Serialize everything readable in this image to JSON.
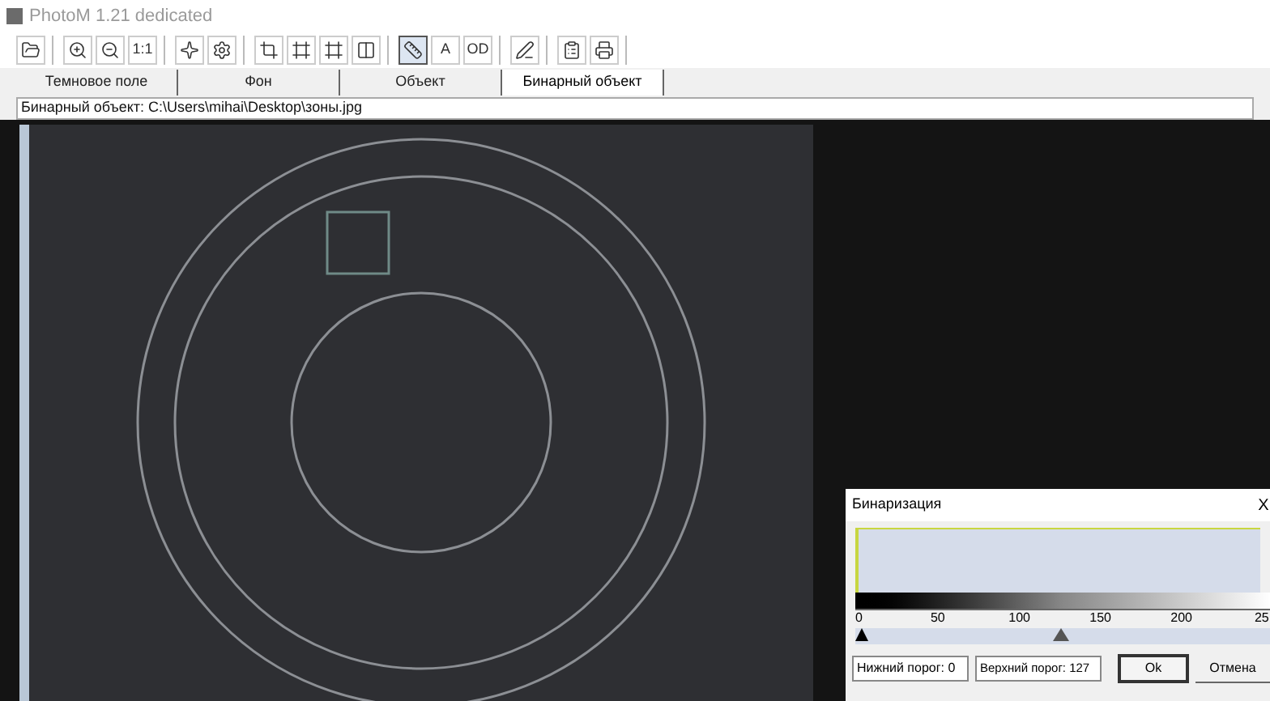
{
  "window": {
    "title": "PhotoM 1.21 dedicated"
  },
  "toolbar": [
    [
      {
        "kind": "icon",
        "pressed": false
      }
    ],
    [
      {
        "kind": "icon",
        "pressed": false
      },
      {
        "kind": "icon",
        "pressed": false
      },
      {
        "kind": "text",
        "text": "1:1",
        "pressed": false
      }
    ],
    [
      {
        "kind": "icon",
        "pressed": false
      },
      {
        "kind": "icon",
        "pressed": false
      }
    ],
    [
      {
        "kind": "icon",
        "pressed": false
      },
      {
        "kind": "icon",
        "pressed": false
      },
      {
        "kind": "icon",
        "pressed": false
      },
      {
        "kind": "icon",
        "pressed": false
      }
    ],
    [
      {
        "kind": "icon",
        "pressed": true
      },
      {
        "kind": "text",
        "text": "A",
        "pressed": false
      },
      {
        "kind": "text",
        "text": "OD",
        "pressed": false
      }
    ],
    [
      {
        "kind": "icon",
        "pressed": false
      }
    ],
    [
      {
        "kind": "icon",
        "pressed": false
      },
      {
        "kind": "icon",
        "pressed": false
      }
    ]
  ],
  "tabs": [
    {
      "label": "Темновое поле",
      "selected": false
    },
    {
      "label": "Фон",
      "selected": false
    },
    {
      "label": "Объект",
      "selected": false
    },
    {
      "label": "Бинарный объект",
      "selected": true
    }
  ],
  "path_line": "Бинарный объект: C:\\Users\\mihai\\Desktop\\зоны.jpg",
  "dialog": {
    "title": "Бинаризация",
    "close": "X",
    "scale_labels": [
      "0",
      "50",
      "100",
      "150",
      "200",
      "25"
    ],
    "lower_marker": {
      "level": 0
    },
    "upper_marker": {
      "level": 0.498
    },
    "lower_threshold": "Нижний порог: 0",
    "upper_threshold": "Верхний порог: 127",
    "buttons": [
      {
        "label": "Ok",
        "default": true
      },
      {
        "label": "Отмена",
        "default": false
      }
    ]
  }
}
